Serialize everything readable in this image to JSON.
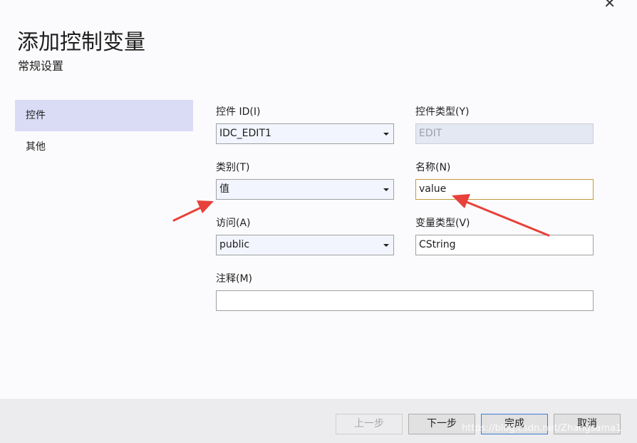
{
  "dialog": {
    "title": "添加控制变量",
    "subtitle": "常规设置",
    "close_glyph": "✕"
  },
  "nav": {
    "items": [
      {
        "label": "控件",
        "selected": true
      },
      {
        "label": "其他",
        "selected": false
      }
    ]
  },
  "form": {
    "control_id": {
      "label": "控件 ID(I)",
      "value": "IDC_EDIT1"
    },
    "control_type": {
      "label": "控件类型(Y)",
      "value": "EDIT"
    },
    "category": {
      "label": "类别(T)",
      "value": "值"
    },
    "name": {
      "label": "名称(N)",
      "value": "value"
    },
    "access": {
      "label": "访问(A)",
      "value": "public"
    },
    "variable_type": {
      "label": "变量类型(V)",
      "value": "CString"
    },
    "comment": {
      "label": "注释(M)",
      "value": ""
    }
  },
  "buttons": {
    "prev": "上一步",
    "next": "下一步",
    "finish": "完成",
    "cancel": "取消"
  },
  "watermark": "https://blog.csdn.net/Zhangsama1",
  "colors": {
    "accent": "#3d7bd4",
    "nav_selected": "#dadcf6",
    "focus_border": "#c29a39",
    "annotation_arrow": "#e8403a"
  }
}
